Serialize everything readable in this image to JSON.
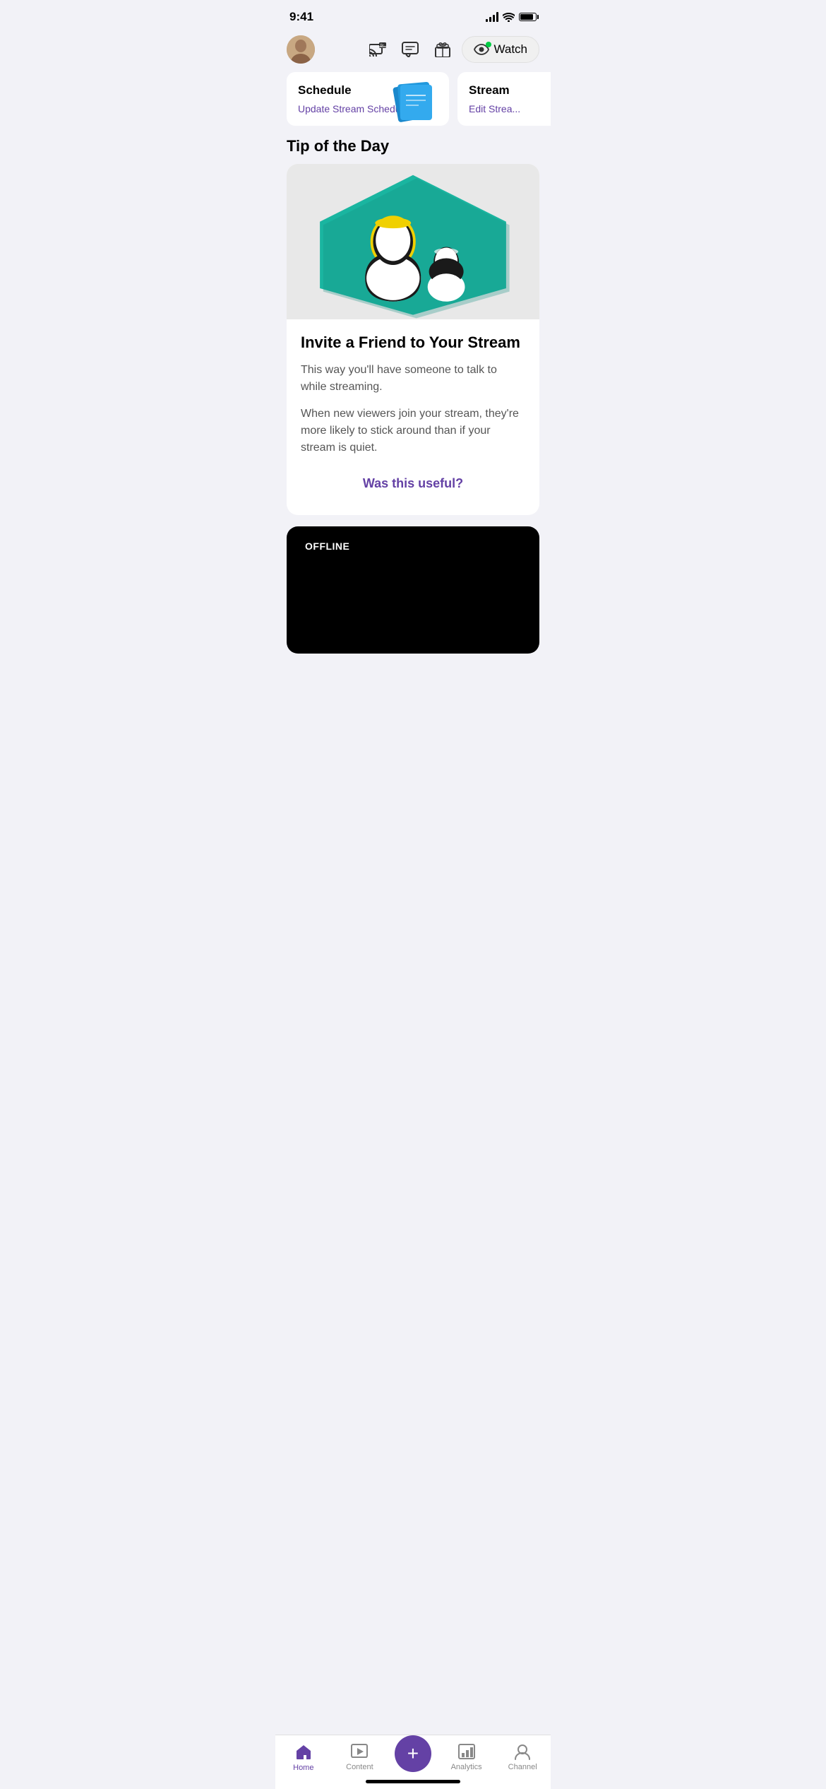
{
  "statusBar": {
    "time": "9:41",
    "signalDots": true
  },
  "topNav": {
    "watchLabel": "Watch"
  },
  "scheduleCard": {
    "title": "Schedule",
    "linkText": "Update Stream Schedule",
    "linkArrow": "›"
  },
  "streamCard": {
    "title": "Stream",
    "linkText": "Edit Strea...",
    "linkArrow": "›"
  },
  "tipSection": {
    "sectionTitle": "Tip of the Day",
    "tipTitle": "Invite a Friend to Your Stream",
    "tipParagraph1": "This way you'll have someone to talk to while streaming.",
    "tipParagraph2": "When new viewers join your stream, they're more likely to stick around than if your stream is quiet.",
    "usefulText": "Was this useful?"
  },
  "offlineCard": {
    "badge": "OFFLINE"
  },
  "bottomNav": {
    "homeLabel": "Home",
    "contentLabel": "Content",
    "addLabel": "+",
    "analyticsLabel": "Analytics",
    "channelLabel": "Channel"
  }
}
